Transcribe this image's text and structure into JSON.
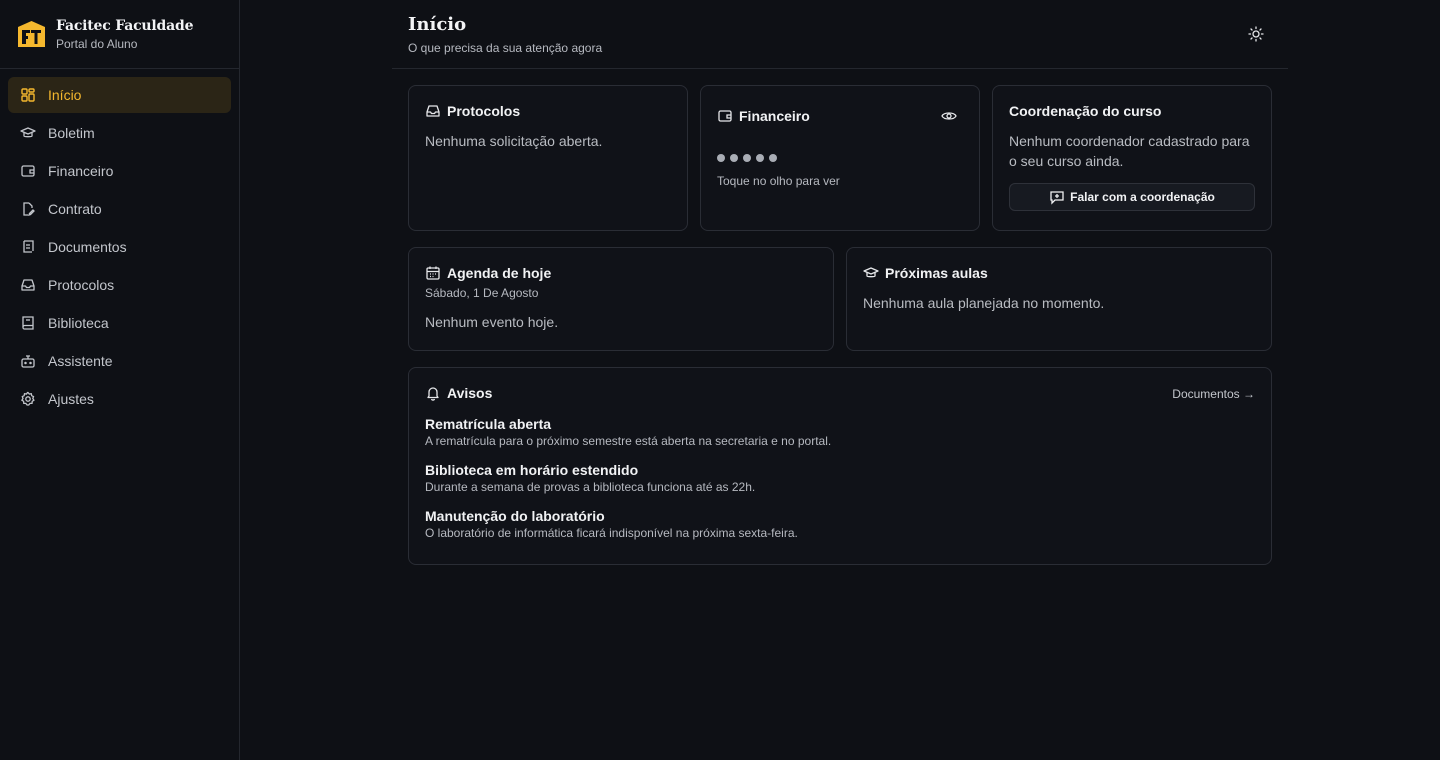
{
  "brand": {
    "name": "Facitec Faculdade",
    "subtitle": "Portal do Aluno"
  },
  "sidebar": {
    "items": [
      {
        "label": "Início",
        "icon": "grid-icon",
        "active": true
      },
      {
        "label": "Boletim",
        "icon": "graduation-cap-icon"
      },
      {
        "label": "Financeiro",
        "icon": "wallet-icon"
      },
      {
        "label": "Contrato",
        "icon": "file-pen-icon"
      },
      {
        "label": "Documentos",
        "icon": "scroll-icon"
      },
      {
        "label": "Protocolos",
        "icon": "inbox-icon"
      },
      {
        "label": "Biblioteca",
        "icon": "book-icon"
      },
      {
        "label": "Assistente",
        "icon": "bot-icon"
      },
      {
        "label": "Ajustes",
        "icon": "gear-icon"
      }
    ]
  },
  "header": {
    "title": "Início",
    "subtitle": "O que precisa da sua atenção agora"
  },
  "cards": {
    "protocolos": {
      "title": "Protocolos",
      "text": "Nenhuma solicitação aberta."
    },
    "financeiro": {
      "title": "Financeiro",
      "hint": "Toque no olho para ver"
    },
    "coordenacao": {
      "title": "Coordenação do curso",
      "text": "Nenhum coordenador cadastrado para o seu curso ainda.",
      "button": "Falar com a coordenação"
    },
    "agenda": {
      "title": "Agenda de hoje",
      "date": "Sábado, 1 De Agosto",
      "text": "Nenhum evento hoje."
    },
    "aulas": {
      "title": "Próximas aulas",
      "text": "Nenhuma aula planejada no momento."
    },
    "avisos": {
      "title": "Avisos",
      "link": "Documentos →",
      "items": [
        {
          "title": "Rematrícula aberta",
          "text": "A rematrícula para o próximo semestre está aberta na secretaria e no portal."
        },
        {
          "title": "Biblioteca em horário estendido",
          "text": "Durante a semana de provas a biblioteca funciona até as 22h."
        },
        {
          "title": "Manutenção do laboratório",
          "text": "O laboratório de informática ficará indisponível na próxima sexta-feira."
        }
      ]
    }
  },
  "colors": {
    "accent": "#f5b82e",
    "background": "#0e1015",
    "card": "#101218",
    "border": "#2a2d35"
  }
}
